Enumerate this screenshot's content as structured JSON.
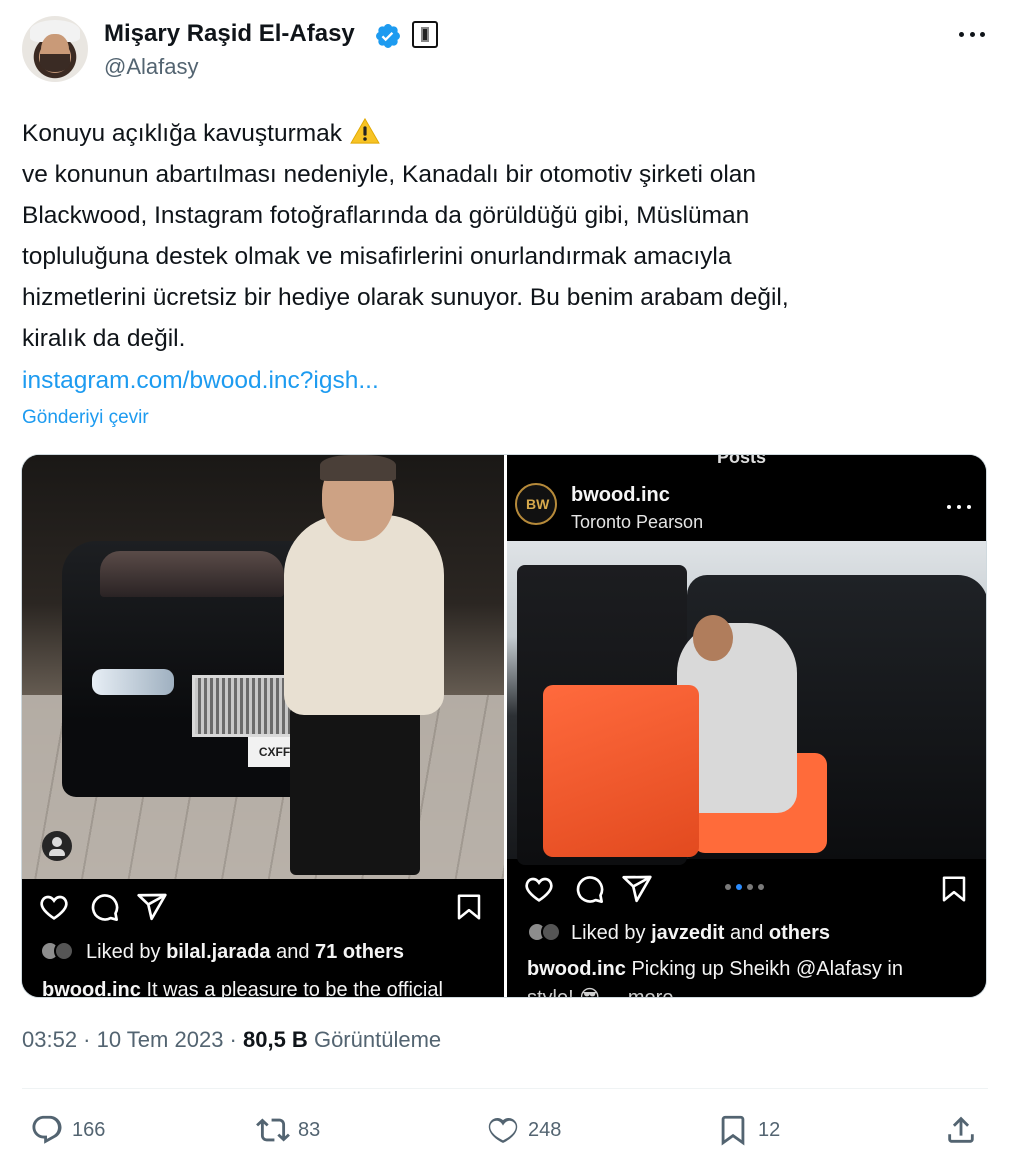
{
  "author": {
    "name": "Mişary Raşid El-Afasy",
    "handle": "@Alafasy",
    "verified": true,
    "affiliate_badge": "building-badge-icon"
  },
  "tweet": {
    "lines": [
      "Konuyu açıklığa kavuşturmak",
      "ve konunun abartılması nedeniyle, Kanadalı bir otomotiv şirketi olan",
      "Blackwood, Instagram fotoğraflarında da görüldüğü gibi, Müslüman",
      "topluluğuna destek olmak ve misafirlerini onurlandırmak amacıyla",
      "hizmetlerini ücretsiz bir hediye olarak sunuyor. Bu benim arabam değil,",
      "kiralık da değil."
    ],
    "link": "instagram.com/bwood.inc?igsh...",
    "translate": "Gönderiyi çevir"
  },
  "media": {
    "left": {
      "plate": "CXFF•8",
      "liked_prefix": "Liked by ",
      "liked_user": "bilal.jarada",
      "liked_and": " and ",
      "liked_count": "71 others",
      "caption_user": "bwood.inc",
      "caption_text": " It was a pleasure to be the official"
    },
    "right": {
      "header_title": "Posts",
      "account": "bwood.inc",
      "location": "Toronto Pearson",
      "liked_prefix": "Liked by ",
      "liked_user": "javzedit",
      "liked_and": " and ",
      "liked_count": "others",
      "caption_user": "bwood.inc",
      "caption_text": " Picking up Sheikh @Alafasy in",
      "caption_more": "style! 😎 ... more"
    }
  },
  "meta": {
    "time": "03:52",
    "date": "10 Tem 2023",
    "views": "80,5 B",
    "views_label": "Görüntüleme"
  },
  "actions": {
    "replies": "166",
    "reposts": "83",
    "likes": "248",
    "bookmarks": "12"
  },
  "colors": {
    "accent": "#1d9bf0",
    "secondary_text": "#536471",
    "primary_text": "#0f1419"
  }
}
